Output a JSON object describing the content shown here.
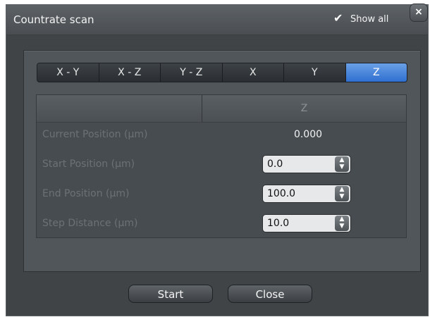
{
  "window": {
    "title": "Countrate scan",
    "show_all_label": "Show all",
    "close_glyph": "×"
  },
  "tabs": [
    {
      "label": "X - Y",
      "active": false
    },
    {
      "label": "X - Z",
      "active": false
    },
    {
      "label": "Y - Z",
      "active": false
    },
    {
      "label": "X",
      "active": false
    },
    {
      "label": "Y",
      "active": false
    },
    {
      "label": "Z",
      "active": true
    }
  ],
  "table": {
    "column_header": "Z",
    "rows": [
      {
        "label": "Current Position (µm)",
        "value": "0.000"
      },
      {
        "label": "Start Position (µm)",
        "value": "0.0"
      },
      {
        "label": "End Position (µm)",
        "value": "100.0"
      },
      {
        "label": "Step Distance (µm)",
        "value": "10.0"
      }
    ]
  },
  "buttons": {
    "start": "Start",
    "close": "Close"
  },
  "icons": {
    "check": "checkmark-icon",
    "spin": "spin-arrows-icon"
  },
  "colors": {
    "active_tab": "#3f7fd9",
    "dialog_bg": "#404447"
  }
}
